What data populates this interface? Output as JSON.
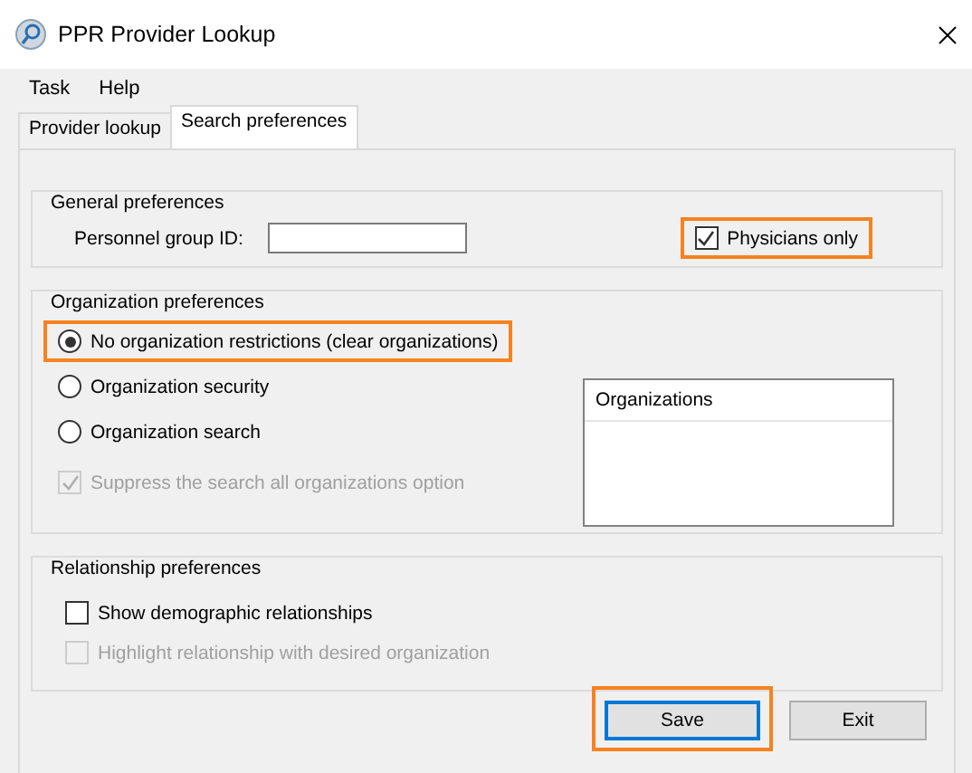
{
  "window": {
    "title": "PPR Provider Lookup"
  },
  "menu": [
    {
      "label": "Task"
    },
    {
      "label": "Help"
    }
  ],
  "tabs": [
    {
      "label": "Provider lookup",
      "selected": false
    },
    {
      "label": "Search preferences",
      "selected": true
    }
  ],
  "general": {
    "title": "General preferences",
    "personnel_label": "Personnel group ID:",
    "physicians_only": {
      "label": "Physicians only",
      "checked": true,
      "highlighted": true
    }
  },
  "organization": {
    "title": "Organization preferences",
    "options": [
      {
        "label": "No organization restrictions (clear organizations)",
        "selected": true,
        "highlighted": true
      },
      {
        "label": "Organization security",
        "selected": false,
        "highlighted": false
      },
      {
        "label": "Organization search",
        "selected": false,
        "highlighted": false
      }
    ],
    "suppress": {
      "label": "Suppress the search all organizations option",
      "checked": true,
      "disabled": true
    },
    "list": {
      "header": "Organizations"
    }
  },
  "relationship": {
    "title": "Relationship preferences",
    "checks": [
      {
        "label": "Show demographic relationships",
        "checked": false,
        "disabled": false
      },
      {
        "label": "Highlight relationship with desired organization",
        "checked": false,
        "disabled": true
      }
    ]
  },
  "buttons": [
    {
      "label": "Save",
      "default": true,
      "highlighted": true
    },
    {
      "label": "Exit",
      "default": false,
      "highlighted": false
    }
  ]
}
